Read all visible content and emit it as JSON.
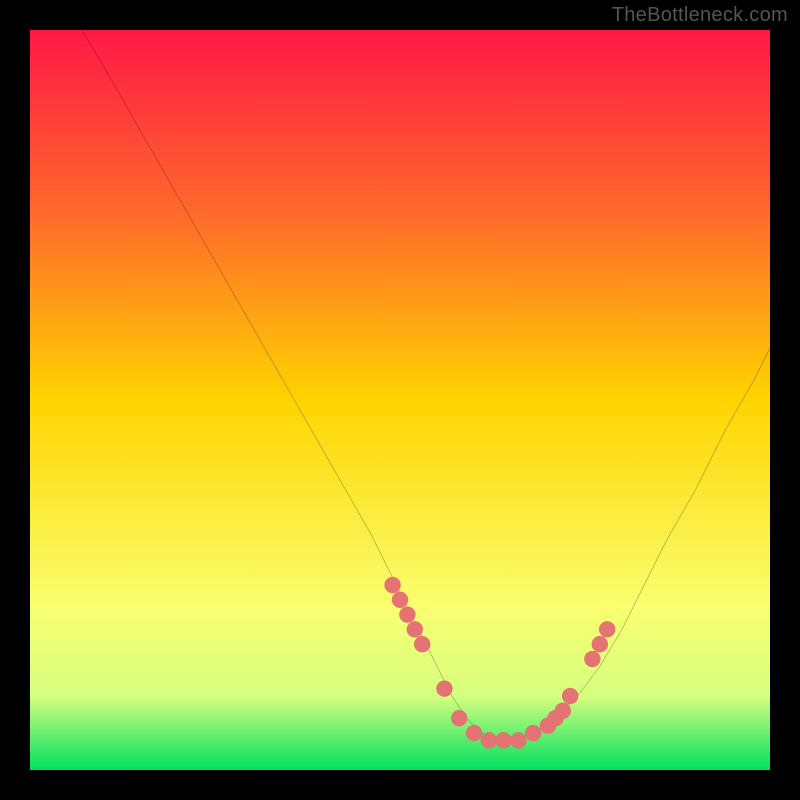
{
  "watermark": "TheBottleneck.com",
  "gradient_colors": {
    "top": "#ff1846",
    "upper_mid": "#ff6a2a",
    "mid": "#ffd400",
    "lower_mid": "#f9ff70",
    "low": "#d6ff80",
    "bottom": "#00e060"
  },
  "chart_data": {
    "type": "line",
    "title": "",
    "xlabel": "",
    "ylabel": "",
    "xlim": [
      0,
      100
    ],
    "ylim": [
      0,
      100
    ],
    "grid": false,
    "line": {
      "name": "bottleneck-curve",
      "color": "#000000",
      "width": 1.6,
      "x": [
        7,
        10,
        14,
        18,
        22,
        26,
        30,
        34,
        38,
        42,
        46,
        49,
        52,
        55,
        57,
        59,
        61,
        63,
        65,
        68,
        71,
        74,
        77,
        80,
        83,
        86,
        90,
        94,
        98,
        100
      ],
      "y": [
        100,
        95,
        88,
        81,
        74,
        67,
        60,
        53,
        46,
        39,
        32,
        26,
        20,
        14,
        10,
        7,
        5,
        4,
        4,
        5,
        7,
        10,
        14,
        19,
        25,
        31,
        38,
        46,
        53,
        57
      ]
    },
    "markers": {
      "name": "highlighted-points",
      "color": "#e57373",
      "stroke": "#d45f5f",
      "radius": 8,
      "x": [
        49,
        50,
        51,
        52,
        53,
        56,
        58,
        60,
        62,
        64,
        66,
        68,
        70,
        71,
        72,
        73,
        76,
        77,
        78
      ],
      "y": [
        25,
        23,
        21,
        19,
        17,
        11,
        7,
        5,
        4,
        4,
        4,
        5,
        6,
        7,
        8,
        10,
        15,
        17,
        19
      ]
    },
    "band_split_y": 21
  }
}
